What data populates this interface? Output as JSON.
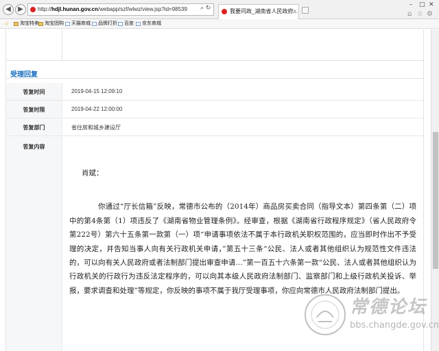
{
  "browser": {
    "back_glyph": "◀",
    "forward_glyph": "▶",
    "url_prefix": "http://",
    "url_host": "hdjl.hunan.gov.cn",
    "url_path": "/webapp/szf/wlwz/view.jsp?id=98539",
    "tab_title": "我要问政_湖南省人民政府...",
    "tab_close": "×",
    "search_glyph": "⌕",
    "refresh_glyph": "↻",
    "minimize": "–",
    "maximize": "□",
    "close": "✕",
    "home_glyph": "⌂",
    "star_glyph": "☆",
    "gear_glyph": "⚙"
  },
  "favorites": [
    {
      "label": "淘宝特卖",
      "icon": "folder-icon"
    },
    {
      "label": "淘宝团购",
      "icon": "folder-icon"
    },
    {
      "label": "天猫商城",
      "icon": "page-icon"
    },
    {
      "label": "品牌打折",
      "icon": "page-icon"
    },
    {
      "label": "百度",
      "icon": "page-icon"
    },
    {
      "label": "京东商城",
      "icon": "page-icon"
    }
  ],
  "section": {
    "title": "受理回复"
  },
  "reply": {
    "time_label": "答复时间",
    "time_value": "2019-04-15 12:09:10",
    "deadline_label": "答复时限",
    "deadline_value": "2019-04-22 12:00:00",
    "dept_label": "答复部门",
    "dept_value": "省住房和城乡建设厅",
    "content_label": "答复内容"
  },
  "letter": {
    "greeting": "肖斌：",
    "body": "你通过“厅长信箱”反映，常德市公布的（2014年）商品房买卖合同（指导文本）第四条第（二）项中的第4条第（1）项违反了《湖南省物业管理条例》。经审查，根据《湖南省行政程序规定》（省人民政府令第222号）第六十五条第一款第（一）项“申请事项依法不属于本行政机关职权范围的，应当即时作出不予受理的决定，并告知当事人向有关行政机关申请，”第五十三条“公民、法人或者其他组织认为规范性文件违法的，可以向有关人民政府或者法制部门提出审查申请…”第一百五十六条第一款“公民、法人或者其他组织认为行政机关的行政行为违反法定程序的，可以向其本级人民政府法制部门、监察部门和上级行政机关投诉、举报，要求调查和处理”等规定，你反映的事项不属于我厅受理事项，你应向常德市人民政府法制部门提出。"
  },
  "watermark": {
    "title": "常德论坛",
    "url": "bbs.changde.gov.cn"
  },
  "colors": {
    "accent": "#1a6fc0",
    "label_bg": "#f6f7f9"
  }
}
